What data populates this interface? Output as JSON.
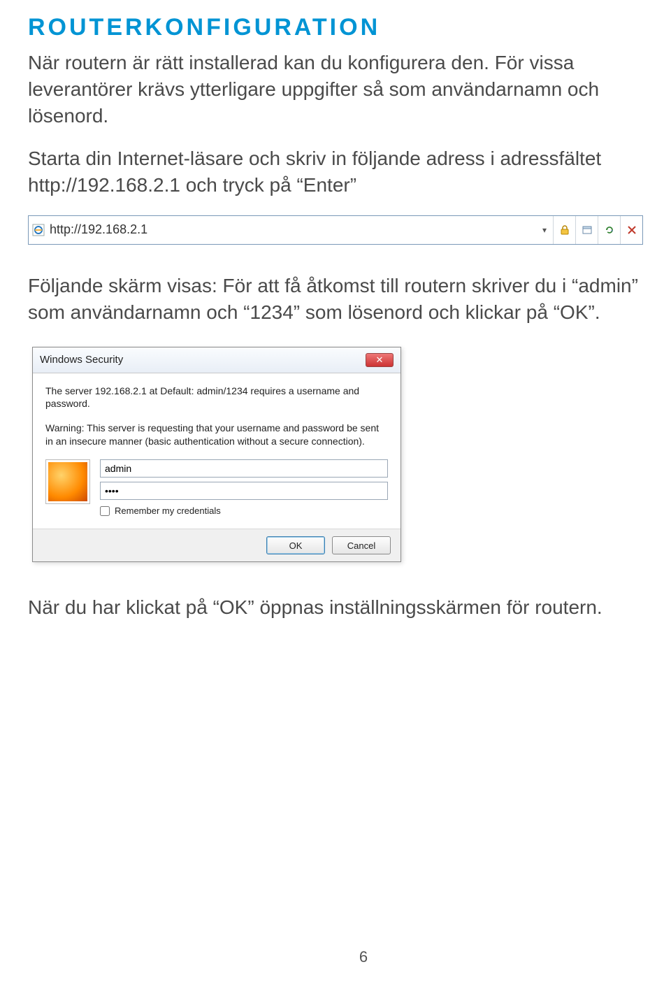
{
  "heading": "ROUTERKONFIGURATION",
  "para1": "När routern är rätt installerad kan du konfigurera den. För vissa leverantörer krävs ytterligare uppgifter så som användarnamn och lösenord.",
  "para2": "Starta din Internet-läsare och skriv in följande adress i adressfältet http://192.168.2.1 och tryck på “Enter”",
  "addressbar": {
    "url": "http://192.168.2.1"
  },
  "para3": "Följande skärm visas: För att få åtkomst till routern skriver du i “admin” som användarnamn och “1234” som lösenord och klickar på “OK”.",
  "dialog": {
    "title": "Windows Security",
    "msg1": "The server 192.168.2.1 at Default: admin/1234 requires a username and password.",
    "msg2": "Warning: This server is requesting that your username and password be sent in an insecure manner (basic authentication without a secure connection).",
    "username_value": "admin",
    "password_value": "••••",
    "remember_label": "Remember my credentials",
    "ok_label": "OK",
    "cancel_label": "Cancel",
    "close_glyph": "✕"
  },
  "para4": "När du har klickat på “OK” öppnas inställningsskärmen för routern.",
  "page_number": "6"
}
